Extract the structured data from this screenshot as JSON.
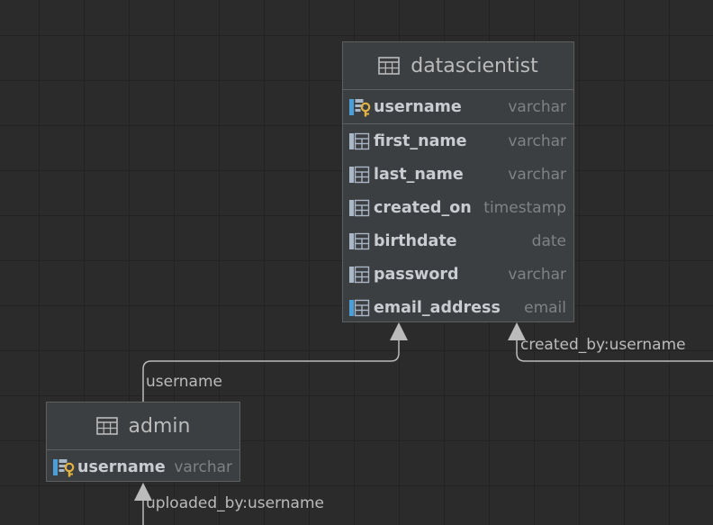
{
  "tables": [
    {
      "name": "datascientist",
      "icon": "table-icon",
      "columns": [
        {
          "name": "username",
          "type": "varchar",
          "primary_key": true,
          "icon": "primary-key-column-icon"
        },
        {
          "name": "first_name",
          "type": "varchar",
          "icon": "column-icon"
        },
        {
          "name": "last_name",
          "type": "varchar",
          "icon": "column-icon"
        },
        {
          "name": "created_on",
          "type": "timestamp",
          "icon": "column-icon"
        },
        {
          "name": "birthdate",
          "type": "date",
          "icon": "column-icon"
        },
        {
          "name": "password",
          "type": "varchar",
          "icon": "column-icon"
        },
        {
          "name": "email_address",
          "type": "email",
          "icon": "column-icon-highlighted"
        }
      ]
    },
    {
      "name": "admin",
      "icon": "table-icon",
      "columns": [
        {
          "name": "username",
          "type": "varchar",
          "primary_key": true,
          "icon": "primary-key-column-icon"
        }
      ]
    }
  ],
  "relations": [
    {
      "label": "username",
      "from": "admin",
      "to": "datascientist"
    },
    {
      "label": "created_by:username",
      "from": "off-canvas-right",
      "to": "datascientist"
    },
    {
      "label": "uploaded_by:username",
      "from": "off-canvas-bottom",
      "to": "admin"
    }
  ],
  "colors": {
    "canvas": "#2b2b2b",
    "grid": "#232323",
    "table_fill": "#3c3f41",
    "table_border": "#5e6060",
    "connector": "#bbbbbb",
    "key_gold": "#e3b341",
    "column_icon": "#a9b7c6",
    "column_icon_highlight": "#4a9fd8"
  }
}
